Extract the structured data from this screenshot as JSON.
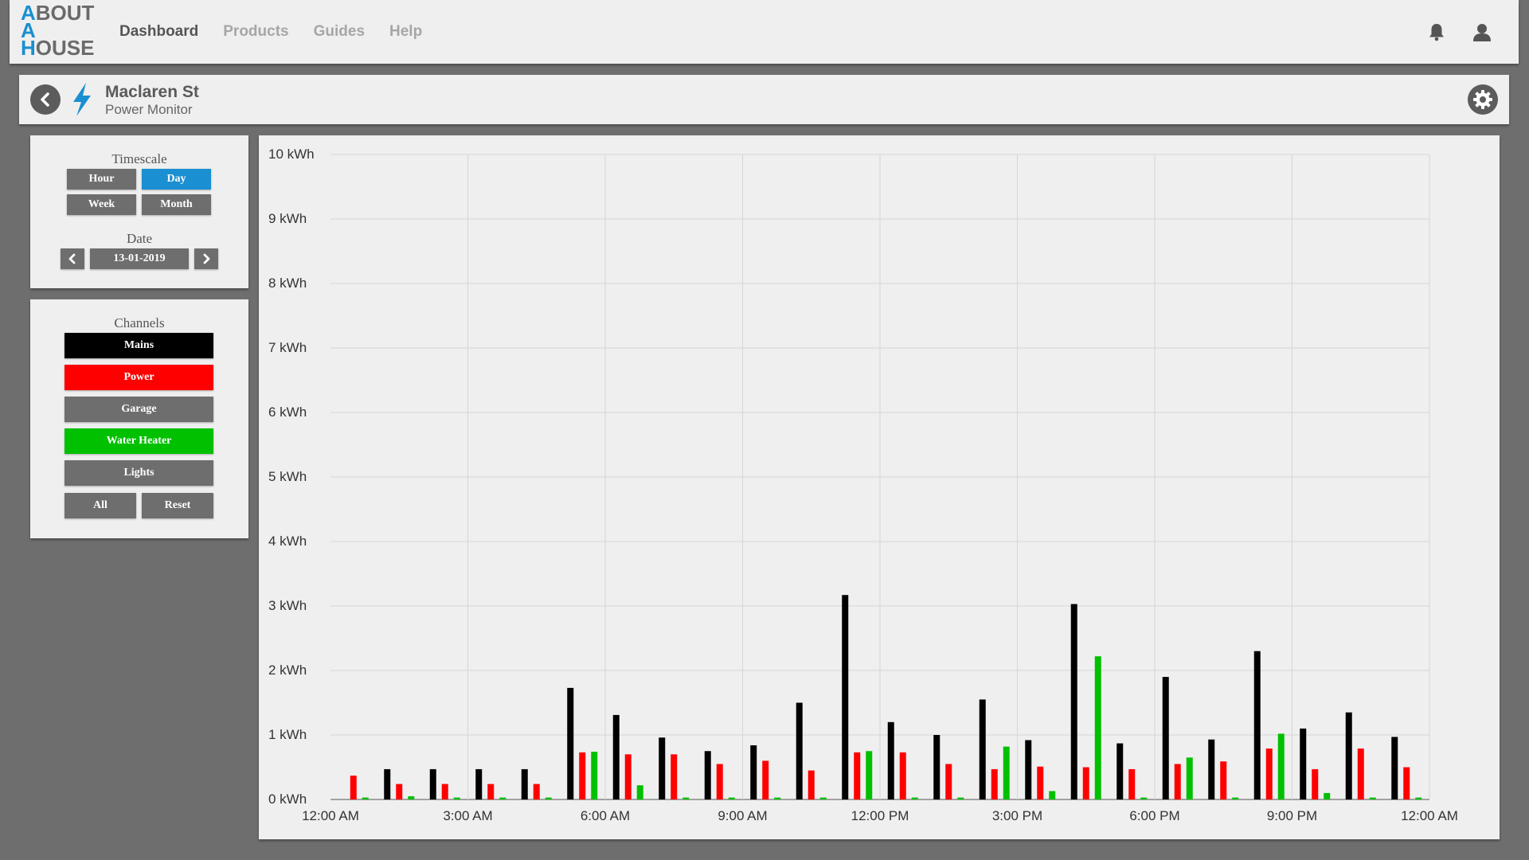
{
  "brand": {
    "line1": "ABOUT",
    "line2": "A",
    "line3": "HOUSE",
    "accent": "#1a8fd1"
  },
  "nav": {
    "items": [
      "Dashboard",
      "Products",
      "Guides",
      "Help"
    ],
    "active": "Dashboard"
  },
  "top_icons": [
    "bell-icon",
    "user-icon"
  ],
  "header": {
    "title": "Maclaren St",
    "subtitle": "Power Monitor",
    "back_icon": "chevron-left-icon",
    "type_icon": "lightning-bolt-icon",
    "settings_icon": "gear-icon"
  },
  "timescale": {
    "title": "Timescale",
    "options": [
      "Hour",
      "Day",
      "Week",
      "Month"
    ],
    "selected": "Day"
  },
  "date": {
    "title": "Date",
    "value": "13-01-2019",
    "prev_icon": "chevron-left-icon",
    "next_icon": "chevron-right-icon"
  },
  "channels": {
    "title": "Channels",
    "items": [
      {
        "label": "Mains",
        "color": "#000000",
        "active": true
      },
      {
        "label": "Power",
        "color": "#ff0000",
        "active": true
      },
      {
        "label": "Garage",
        "color": "#6e6e6e",
        "active": false
      },
      {
        "label": "Water Heater",
        "color": "#00c000",
        "active": true
      },
      {
        "label": "Lights",
        "color": "#6e6e6e",
        "active": false
      }
    ],
    "all_label": "All",
    "reset_label": "Reset"
  },
  "chart_data": {
    "type": "bar",
    "y_unit": "kWh",
    "ylim": [
      0,
      10
    ],
    "y_ticks": [
      "0 kWh",
      "1 kWh",
      "2 kWh",
      "3 kWh",
      "4 kWh",
      "5 kWh",
      "6 kWh",
      "7 kWh",
      "8 kWh",
      "9 kWh",
      "10 kWh"
    ],
    "x_ticks": [
      "12:00 AM",
      "3:00 AM",
      "6:00 AM",
      "9:00 AM",
      "12:00 PM",
      "3:00 PM",
      "6:00 PM",
      "9:00 PM",
      "12:00 AM"
    ],
    "grid": true,
    "categories": [
      "12:00 AM",
      "1:00 AM",
      "2:00 AM",
      "3:00 AM",
      "4:00 AM",
      "5:00 AM",
      "6:00 AM",
      "7:00 AM",
      "8:00 AM",
      "9:00 AM",
      "10:00 AM",
      "11:00 AM",
      "12:00 PM",
      "1:00 PM",
      "2:00 PM",
      "3:00 PM",
      "4:00 PM",
      "5:00 PM",
      "6:00 PM",
      "7:00 PM",
      "8:00 PM",
      "9:00 PM",
      "10:00 PM",
      "11:00 PM"
    ],
    "series": [
      {
        "name": "Mains",
        "color": "#000000",
        "values": [
          0.0,
          0.47,
          0.47,
          0.47,
          0.47,
          1.73,
          1.31,
          0.96,
          0.75,
          0.84,
          1.5,
          3.17,
          1.2,
          1.0,
          1.55,
          0.92,
          3.03,
          0.87,
          1.9,
          0.93,
          2.3,
          1.1,
          1.35,
          0.97
        ]
      },
      {
        "name": "Power",
        "color": "#ff0000",
        "values": [
          0.37,
          0.24,
          0.24,
          0.24,
          0.24,
          0.73,
          0.7,
          0.7,
          0.55,
          0.6,
          0.45,
          0.73,
          0.73,
          0.55,
          0.47,
          0.51,
          0.5,
          0.47,
          0.55,
          0.59,
          0.79,
          0.47,
          0.79,
          0.5
        ]
      },
      {
        "name": "Water Heater",
        "color": "#00c000",
        "values": [
          0.03,
          0.05,
          0.03,
          0.03,
          0.03,
          0.74,
          0.22,
          0.03,
          0.03,
          0.03,
          0.03,
          0.75,
          0.03,
          0.03,
          0.82,
          0.13,
          2.22,
          0.03,
          0.65,
          0.03,
          1.02,
          0.1,
          0.03,
          0.03
        ]
      }
    ]
  }
}
